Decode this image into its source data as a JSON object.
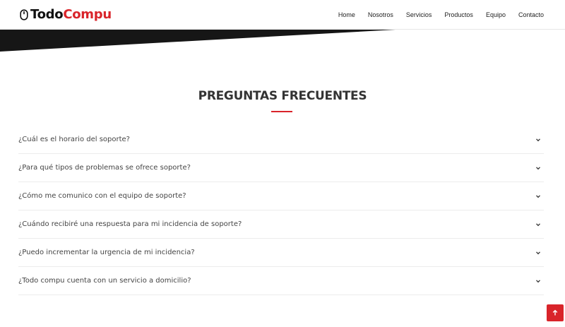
{
  "brand": {
    "name_part1": "Todo",
    "name_part2": "Compu",
    "icon": "mouse-icon",
    "accent_color": "#d9242a"
  },
  "nav": {
    "items": [
      {
        "label": "Home"
      },
      {
        "label": "Nosotros"
      },
      {
        "label": "Servicios"
      },
      {
        "label": "Productos"
      },
      {
        "label": "Equipo"
      },
      {
        "label": "Contacto"
      }
    ]
  },
  "faq": {
    "title": "PREGUNTAS FRECUENTES",
    "questions": [
      {
        "text": "¿Cuál es el horario del soporte?",
        "icon": "chevron-down-icon"
      },
      {
        "text": "¿Para qué tipos de problemas se ofrece soporte?",
        "icon": "chevron-down-icon"
      },
      {
        "text": "¿Cómo me comunico con el equipo de soporte?",
        "icon": "chevron-down-icon"
      },
      {
        "text": "¿Cuándo recibiré una respuesta para mi incidencia de soporte?",
        "icon": "chevron-down-icon"
      },
      {
        "text": "¿Puedo incrementar la urgencia de mi incidencia?",
        "icon": "chevron-down-icon"
      },
      {
        "text": "¿Todo compu cuenta con un servicio a domicilio?",
        "icon": "chevron-down-icon"
      }
    ]
  },
  "back_to_top": {
    "icon": "arrow-up-icon"
  }
}
